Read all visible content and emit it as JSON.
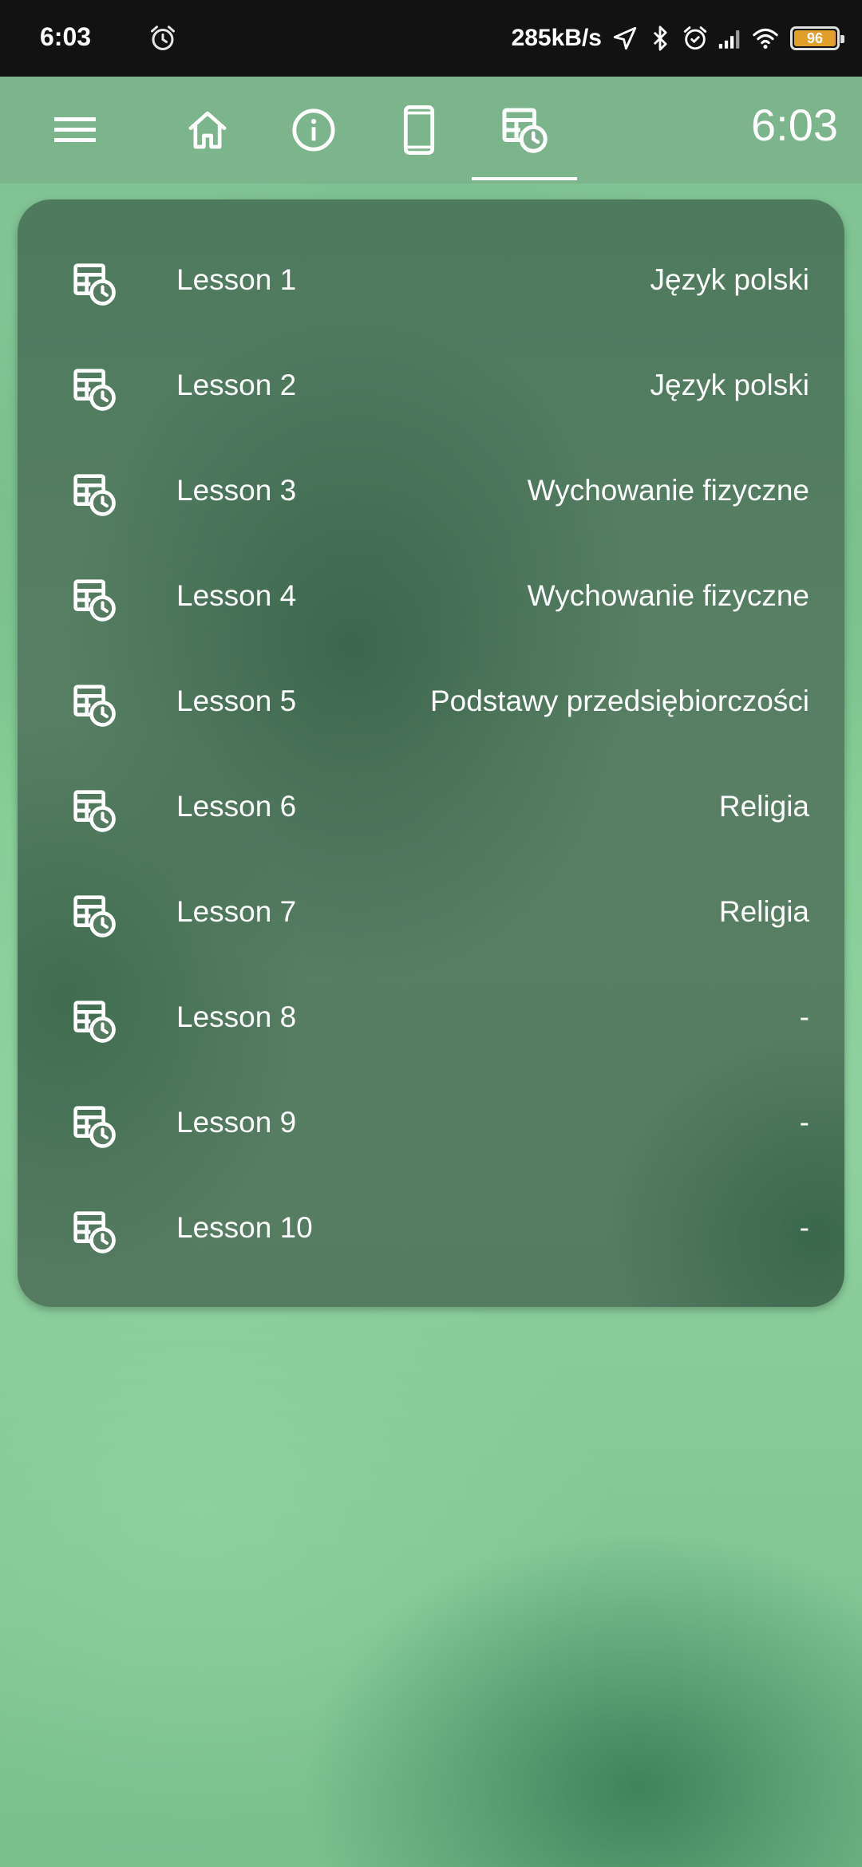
{
  "status_bar": {
    "time": "6:03",
    "network_speed": "285kB/s",
    "battery_level": "96",
    "icons": [
      "alarm-icon",
      "location-arrow-icon",
      "bluetooth-icon",
      "alarm-icon",
      "signal-icon",
      "wifi-icon",
      "battery-icon"
    ]
  },
  "app_bar": {
    "menu_icon": "hamburger-menu-icon",
    "tabs": [
      {
        "icon": "home-icon",
        "selected": false
      },
      {
        "icon": "info-icon",
        "selected": false
      },
      {
        "icon": "phone-device-icon",
        "selected": false
      },
      {
        "icon": "timetable-clock-icon",
        "selected": true
      }
    ],
    "time": "6:03"
  },
  "lessons": [
    {
      "label": "Lesson 1",
      "subject": "Język polski"
    },
    {
      "label": "Lesson 2",
      "subject": "Język polski"
    },
    {
      "label": "Lesson 3",
      "subject": "Wychowanie fizyczne"
    },
    {
      "label": "Lesson 4",
      "subject": "Wychowanie fizyczne"
    },
    {
      "label": "Lesson 5",
      "subject": "Podstawy przedsiębiorczości"
    },
    {
      "label": "Lesson 6",
      "subject": "Religia"
    },
    {
      "label": "Lesson 7",
      "subject": "Religia"
    },
    {
      "label": "Lesson 8",
      "subject": "-"
    },
    {
      "label": "Lesson 9",
      "subject": "-"
    },
    {
      "label": "Lesson 10",
      "subject": "-"
    }
  ],
  "colors": {
    "status_bar_bg": "#121212",
    "card_bg": "#557b61",
    "background_green": "#86cd97",
    "battery_fill": "#e0a02c",
    "text": "#ffffff"
  }
}
